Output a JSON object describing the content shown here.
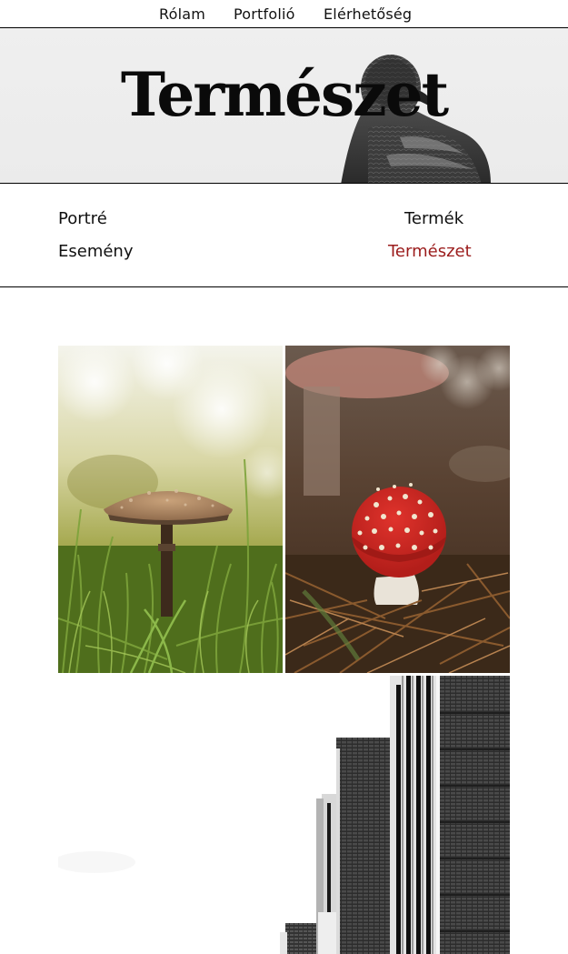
{
  "nav": {
    "items": [
      {
        "label": "Rólam"
      },
      {
        "label": "Portfolió"
      },
      {
        "label": "Elérhetőség"
      }
    ]
  },
  "hero": {
    "title": "Természet"
  },
  "categories": {
    "items": [
      {
        "label": "Portré"
      },
      {
        "label": "Termék"
      },
      {
        "label": "Esemény"
      },
      {
        "label": "Természet"
      }
    ],
    "active": "Természet",
    "active_color": "#9b1c1c"
  },
  "gallery": {
    "images": [
      {
        "subject": "parasol mushroom in grass"
      },
      {
        "subject": "red fly agaric mushroom on pine needles"
      },
      {
        "subject": "black and white tall buildings"
      }
    ]
  }
}
